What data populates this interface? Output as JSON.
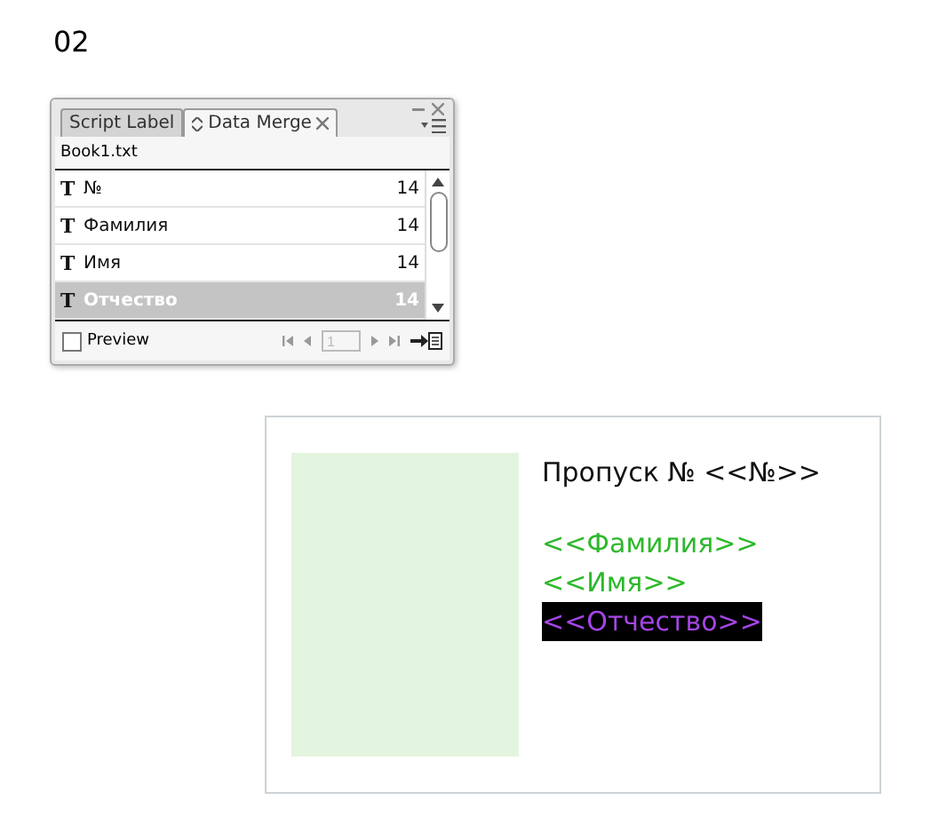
{
  "page_label": "02",
  "panel": {
    "tabs": [
      {
        "label": "Script Label",
        "selected": false
      },
      {
        "label": "Data Merge",
        "selected": true
      }
    ],
    "source_file": "Book1.txt",
    "fields": [
      {
        "icon": "T",
        "name": "№",
        "count": "14",
        "selected": false
      },
      {
        "icon": "T",
        "name": "Фамилия",
        "count": "14",
        "selected": false
      },
      {
        "icon": "T",
        "name": "Имя",
        "count": "14",
        "selected": false
      },
      {
        "icon": "T",
        "name": "Отчество",
        "count": "14",
        "selected": true
      }
    ],
    "preview": {
      "label": "Preview",
      "checked": false
    },
    "record": "1"
  },
  "card": {
    "title": "Пропуск № <<№>>",
    "placeholders": [
      {
        "text": "<<Фамилия>>",
        "selected": false
      },
      {
        "text": "<<Имя>>",
        "selected": false
      },
      {
        "text": "<<Отчество>>",
        "selected": true
      }
    ]
  }
}
